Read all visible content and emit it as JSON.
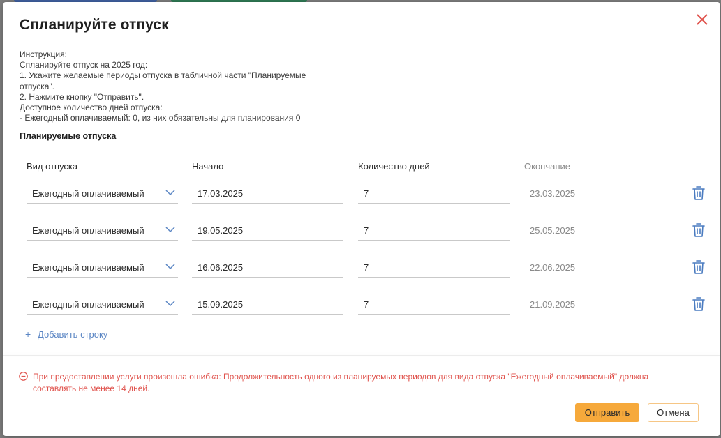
{
  "dialog": {
    "title": "Спланируйте отпуск",
    "close_icon": "close-icon"
  },
  "instructions": {
    "lines": [
      "Инструкция:",
      "Спланируйте отпуск на 2025 год:",
      "1. Укажите желаемые периоды отпуска в табличной части \"Планируемые отпуска\".",
      "2. Нажмите кнопку \"Отправить\".",
      "Доступное количество дней отпуска:",
      "- Ежегодный оплачиваемый: 0, из них обязательны для планирования 0"
    ]
  },
  "table": {
    "section_title": "Планируемые отпуска",
    "headers": {
      "type": "Вид отпуска",
      "start": "Начало",
      "days": "Количество дней",
      "end": "Окончание"
    },
    "rows": [
      {
        "type": "Ежегодный оплачиваемый",
        "start": "17.03.2025",
        "days": "7",
        "end": "23.03.2025"
      },
      {
        "type": "Ежегодный оплачиваемый",
        "start": "19.05.2025",
        "days": "7",
        "end": "25.05.2025"
      },
      {
        "type": "Ежегодный оплачиваемый",
        "start": "16.06.2025",
        "days": "7",
        "end": "22.06.2025"
      },
      {
        "type": "Ежегодный оплачиваемый",
        "start": "15.09.2025",
        "days": "7",
        "end": "21.09.2025"
      }
    ],
    "add_row_label": "Добавить строку",
    "row_icons": {
      "dropdown": "chevron-down-icon",
      "delete": "trash-icon"
    }
  },
  "error": {
    "icon": "minus-circle-icon",
    "text": "При предоставлении услуги произошла ошибка: Продолжительность одного из планируемых периодов для вида отпуска \"Ежегодный оплачиваемый\" должна составлять не менее 14 дней."
  },
  "buttons": {
    "submit": "Отправить",
    "cancel": "Отмена"
  },
  "colors": {
    "accent": "#f6a93b",
    "link": "#5b86c4",
    "error": "#e0534d",
    "close": "#e0534d"
  }
}
